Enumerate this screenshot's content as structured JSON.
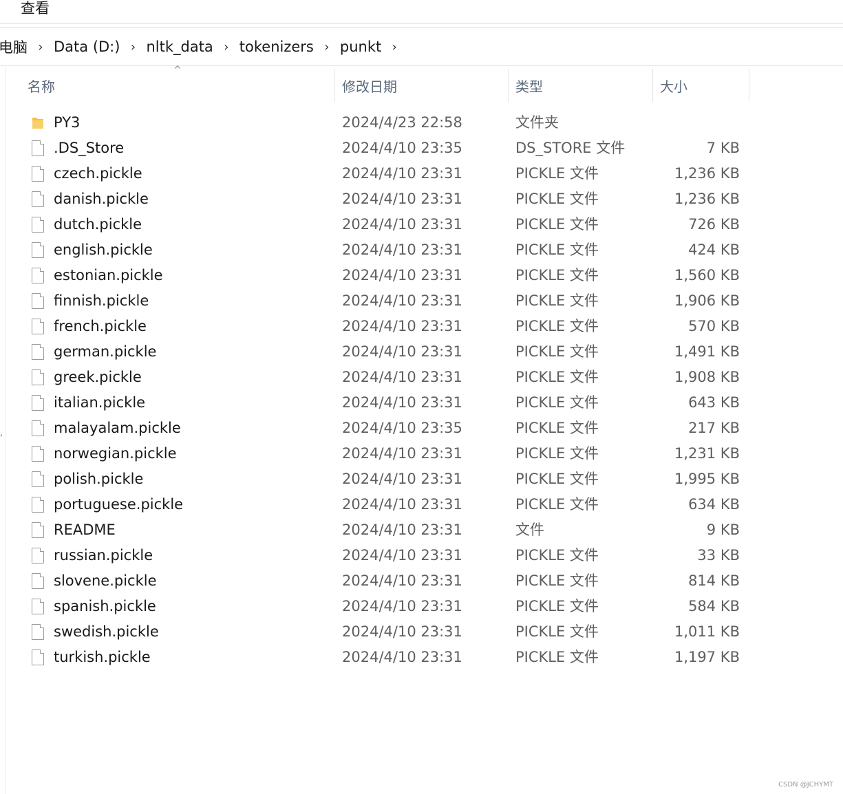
{
  "menu": {
    "view_label": "查看"
  },
  "breadcrumb": {
    "items": [
      "电脑",
      "Data (D:)",
      "nltk_data",
      "tokenizers",
      "punkt"
    ]
  },
  "columns": {
    "name": "名称",
    "date": "修改日期",
    "type": "类型",
    "size": "大小"
  },
  "files": [
    {
      "name": "PY3",
      "date": "2024/4/23 22:58",
      "type": "文件夹",
      "size": "",
      "icon": "folder-icon"
    },
    {
      "name": ".DS_Store",
      "date": "2024/4/10 23:35",
      "type": "DS_STORE 文件",
      "size": "7 KB",
      "icon": "file-icon"
    },
    {
      "name": "czech.pickle",
      "date": "2024/4/10 23:31",
      "type": "PICKLE 文件",
      "size": "1,236 KB",
      "icon": "file-icon"
    },
    {
      "name": "danish.pickle",
      "date": "2024/4/10 23:31",
      "type": "PICKLE 文件",
      "size": "1,236 KB",
      "icon": "file-icon"
    },
    {
      "name": "dutch.pickle",
      "date": "2024/4/10 23:31",
      "type": "PICKLE 文件",
      "size": "726 KB",
      "icon": "file-icon"
    },
    {
      "name": "english.pickle",
      "date": "2024/4/10 23:31",
      "type": "PICKLE 文件",
      "size": "424 KB",
      "icon": "file-icon"
    },
    {
      "name": "estonian.pickle",
      "date": "2024/4/10 23:31",
      "type": "PICKLE 文件",
      "size": "1,560 KB",
      "icon": "file-icon"
    },
    {
      "name": "finnish.pickle",
      "date": "2024/4/10 23:31",
      "type": "PICKLE 文件",
      "size": "1,906 KB",
      "icon": "file-icon"
    },
    {
      "name": "french.pickle",
      "date": "2024/4/10 23:31",
      "type": "PICKLE 文件",
      "size": "570 KB",
      "icon": "file-icon"
    },
    {
      "name": "german.pickle",
      "date": "2024/4/10 23:31",
      "type": "PICKLE 文件",
      "size": "1,491 KB",
      "icon": "file-icon"
    },
    {
      "name": "greek.pickle",
      "date": "2024/4/10 23:31",
      "type": "PICKLE 文件",
      "size": "1,908 KB",
      "icon": "file-icon"
    },
    {
      "name": "italian.pickle",
      "date": "2024/4/10 23:31",
      "type": "PICKLE 文件",
      "size": "643 KB",
      "icon": "file-icon"
    },
    {
      "name": "malayalam.pickle",
      "date": "2024/4/10 23:35",
      "type": "PICKLE 文件",
      "size": "217 KB",
      "icon": "file-icon"
    },
    {
      "name": "norwegian.pickle",
      "date": "2024/4/10 23:31",
      "type": "PICKLE 文件",
      "size": "1,231 KB",
      "icon": "file-icon"
    },
    {
      "name": "polish.pickle",
      "date": "2024/4/10 23:31",
      "type": "PICKLE 文件",
      "size": "1,995 KB",
      "icon": "file-icon"
    },
    {
      "name": "portuguese.pickle",
      "date": "2024/4/10 23:31",
      "type": "PICKLE 文件",
      "size": "634 KB",
      "icon": "file-icon"
    },
    {
      "name": "README",
      "date": "2024/4/10 23:31",
      "type": "文件",
      "size": "9 KB",
      "icon": "file-icon"
    },
    {
      "name": "russian.pickle",
      "date": "2024/4/10 23:31",
      "type": "PICKLE 文件",
      "size": "33 KB",
      "icon": "file-icon"
    },
    {
      "name": "slovene.pickle",
      "date": "2024/4/10 23:31",
      "type": "PICKLE 文件",
      "size": "814 KB",
      "icon": "file-icon"
    },
    {
      "name": "spanish.pickle",
      "date": "2024/4/10 23:31",
      "type": "PICKLE 文件",
      "size": "584 KB",
      "icon": "file-icon"
    },
    {
      "name": "swedish.pickle",
      "date": "2024/4/10 23:31",
      "type": "PICKLE 文件",
      "size": "1,011 KB",
      "icon": "file-icon"
    },
    {
      "name": "turkish.pickle",
      "date": "2024/4/10 23:31",
      "type": "PICKLE 文件",
      "size": "1,197 KB",
      "icon": "file-icon"
    }
  ],
  "watermark": "CSDN @JCHYMT",
  "colors": {
    "folder": "#f4c04e",
    "header_text": "#5c6b7c",
    "detail_text": "#5f5f5f"
  }
}
